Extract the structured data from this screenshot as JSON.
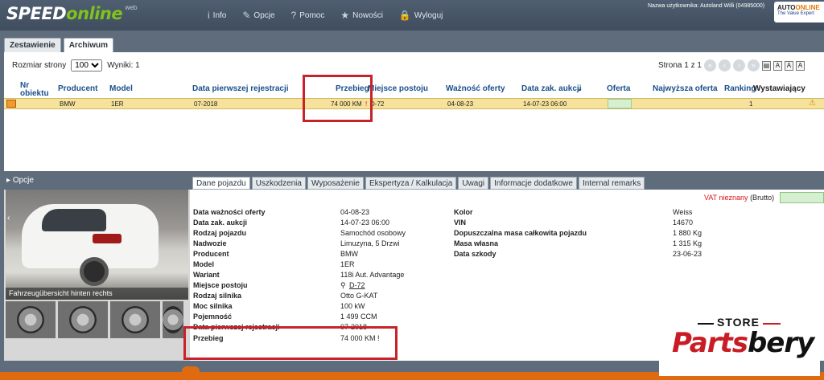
{
  "header": {
    "logo_main": "SPEED",
    "logo_accent": "online",
    "logo_suffix": "web",
    "nav": [
      {
        "label": "Info",
        "icon": "info-icon",
        "glyph": "i"
      },
      {
        "label": "Opcje",
        "icon": "wrench-icon",
        "glyph": "✎"
      },
      {
        "label": "Pomoc",
        "icon": "help-icon",
        "glyph": "?"
      },
      {
        "label": "Nowości",
        "icon": "star-icon",
        "glyph": "★"
      },
      {
        "label": "Wyloguj",
        "icon": "lock-icon",
        "glyph": "🔒"
      }
    ],
    "user_info": "Nazwa użytkownika: Autoland Willi (04985000)",
    "brand_top": "AUTO",
    "brand_top_accent": "ONLINE",
    "brand_sub": "The Value Expert"
  },
  "tabs": [
    "Zestawienie",
    "Archiwum"
  ],
  "list": {
    "page_size_label": "Rozmiar strony",
    "page_size_value": "100",
    "results": "Wyniki: 1",
    "pager_text": "Strona 1 z 1",
    "font_sizes": [
      "A",
      "A",
      "A"
    ],
    "columns": [
      "Nr obiektu",
      "Producent",
      "Model",
      "Data pierwszej rejestracji",
      "Przebieg",
      "Miejsce postoju",
      "Ważność oferty",
      "Data zak. aukcji",
      "Oferta",
      "Najwyższa oferta",
      "Ranking",
      "Wystawiający"
    ],
    "row": {
      "producent": "BMW",
      "model": "1ER",
      "data_rejestracji": "07-2018",
      "przebieg": "74 000 KM",
      "przebieg_mark": "!",
      "miejsce": "D-72",
      "waznosc": "04-08-23",
      "data_aukcji": "14-07-23 06:00",
      "ranking": "1"
    }
  },
  "options_label": "Opcje",
  "gallery": {
    "caption": "Fahrzeugübersicht hinten rechts"
  },
  "detail_tabs": [
    "Dane pojazdu",
    "Uszkodzenia",
    "Wyposażenie",
    "Ekspertyza / Kalkulacja",
    "Uwagi",
    "Informacje dodatkowe",
    "Internal remarks"
  ],
  "vat": {
    "red": "VAT nieznany",
    "rest": "(Brutto)"
  },
  "details_left": [
    {
      "k": "Data ważności oferty",
      "v": "04-08-23"
    },
    {
      "k": "Data zak. aukcji",
      "v": "14-07-23 06:00"
    },
    {
      "k": "Rodzaj pojazdu",
      "v": "Samochód osobowy"
    },
    {
      "k": "Nadwozie",
      "v": "Limuzyna, 5 Drzwi"
    },
    {
      "k": "Producent",
      "v": "BMW"
    },
    {
      "k": "Model",
      "v": "1ER"
    },
    {
      "k": "Wariant",
      "v": "118i Aut. Advantage"
    },
    {
      "k": "Miejsce postoju",
      "v": "D-72"
    },
    {
      "k": "Rodzaj silnika",
      "v": "Otto G-KAT"
    },
    {
      "k": "Moc silnika",
      "v": "100 kW"
    },
    {
      "k": "Pojemność",
      "v": "1 499 CCM"
    },
    {
      "k": "Data pierwszej rejestracji",
      "v": "07-2018"
    },
    {
      "k": "Przebieg",
      "v": "74 000 KM !"
    }
  ],
  "details_right": [
    {
      "k": "Kolor",
      "v": "Weiss"
    },
    {
      "k": "VIN",
      "v": "14670"
    },
    {
      "k": "Dopuszczalna masa całkowita pojazdu",
      "v": "1 880 Kg"
    },
    {
      "k": "Masa własna",
      "v": "1 315 Kg"
    },
    {
      "k": "Data szkody",
      "v": "23-06-23"
    }
  ],
  "watermark": {
    "store": "STORE",
    "name_red": "Parts",
    "name_dark": "bery"
  },
  "colors": {
    "accent_green": "#7fc21d",
    "highlight_red": "#c8232a",
    "row_yellow": "#f6e29b",
    "header_bg": "#4f5e70",
    "orange": "#e06a10"
  }
}
